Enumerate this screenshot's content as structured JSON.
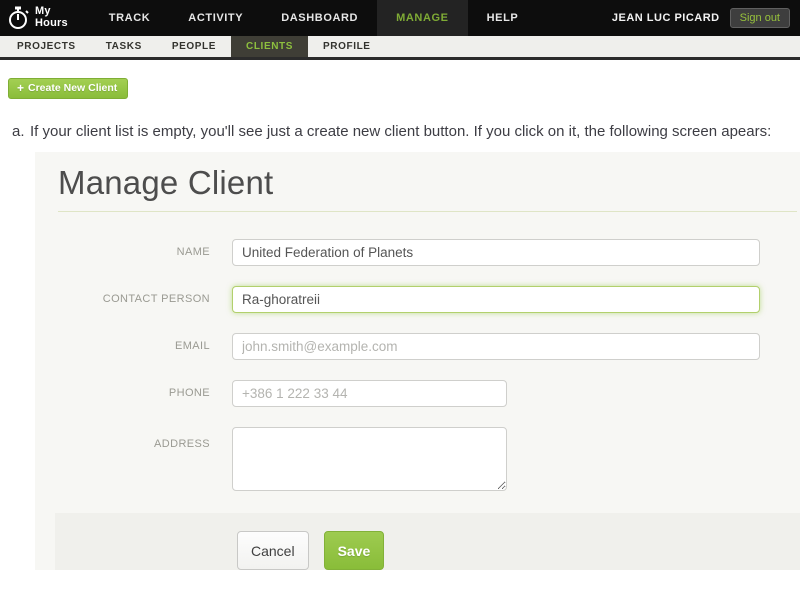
{
  "colors": {
    "nav_bg": "#0d0d0d",
    "brand_green": "#8dbf3e",
    "button_green": "#8abd3a",
    "panel_bg": "#f7f7f4"
  },
  "nav": {
    "logo": {
      "line1": "My",
      "line2": "Hours"
    },
    "items": [
      {
        "label": "TRACK"
      },
      {
        "label": "ACTIVITY"
      },
      {
        "label": "DASHBOARD"
      },
      {
        "label": "MANAGE"
      },
      {
        "label": "HELP"
      }
    ],
    "active_item": "MANAGE",
    "user": "JEAN LUC PICARD",
    "sign_out_label": "Sign out"
  },
  "subnav": {
    "items": [
      {
        "label": "PROJECTS"
      },
      {
        "label": "TASKS"
      },
      {
        "label": "PEOPLE"
      },
      {
        "label": "CLIENTS"
      },
      {
        "label": "PROFILE"
      }
    ],
    "active_item": "CLIENTS"
  },
  "toolbar": {
    "create_client_plus": "+",
    "create_client_label": "Create New Client"
  },
  "note": {
    "marker": "a.",
    "text": "If your client list is empty, you'll see just a create new client button. If you click on it, the following screen apears:"
  },
  "form": {
    "title": "Manage Client",
    "fields": {
      "name": {
        "label": "NAME",
        "value": "United Federation of Planets"
      },
      "contact": {
        "label": "CONTACT PERSON",
        "value": "Ra-ghoratreii"
      },
      "email": {
        "label": "EMAIL",
        "placeholder": "john.smith@example.com"
      },
      "phone": {
        "label": "PHONE",
        "placeholder": "+386 1 222 33 44"
      },
      "address": {
        "label": "ADDRESS",
        "value": ""
      }
    },
    "buttons": {
      "cancel": "Cancel",
      "save": "Save"
    }
  }
}
